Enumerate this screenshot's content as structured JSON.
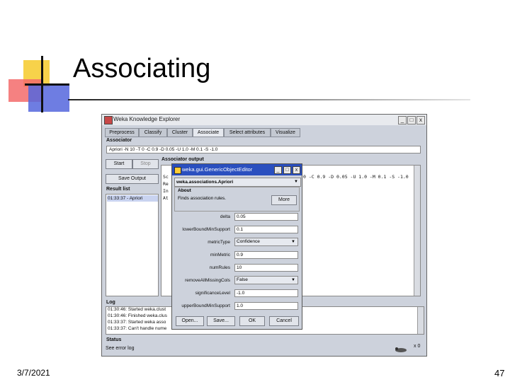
{
  "slide": {
    "title": "Associating",
    "date": "3/7/2021",
    "page_number": "47"
  },
  "window": {
    "title": "Weka Knowledge Explorer",
    "minimize": "_",
    "maximize": "□",
    "close": "x"
  },
  "tabs": [
    {
      "label": "Preprocess"
    },
    {
      "label": "Classify"
    },
    {
      "label": "Cluster"
    },
    {
      "label": "Associate"
    },
    {
      "label": "Select attributes"
    },
    {
      "label": "Visualize"
    }
  ],
  "associator": {
    "label": "Associator",
    "value": "Apriori -N 10 -T 0 -C 0.9 -D 0.05 -U 1.0 -M 0.1 -S -1.0"
  },
  "controls": {
    "start": "Start",
    "stop": "Stop",
    "save_output": "Save Output",
    "result_list_label": "Result list",
    "result_item": "01:33:37 - Apriori"
  },
  "output": {
    "label": "Associator output",
    "lines": [
      "Sc",
      "Re",
      "In",
      "At"
    ],
    "right_text": "0 -C 0.9 -D 0.05 -U 1.0 -M 0.1 -S -1.0"
  },
  "log": {
    "label": "Log",
    "lines": [
      "01:30:46: Started weka.clust",
      "01:30:46: Finished weka.clus",
      "01:33:37: Started weka asso",
      "01:33:37: Can't handle nume"
    ]
  },
  "status": {
    "label": "Status",
    "text": "See error log",
    "count": "x 0"
  },
  "dialog": {
    "title": "weka.gui.GenericObjectEditor",
    "class_name": "weka.associations.Apriori",
    "about_label": "About",
    "about_text": "Finds association rules.",
    "more_button": "More",
    "params": {
      "delta": {
        "label": "delta",
        "value": "0.05"
      },
      "lowerBoundMinSupport": {
        "label": "lowerBoundMinSupport",
        "value": "0.1"
      },
      "metricType": {
        "label": "metricType",
        "value": "Confidence"
      },
      "minMetric": {
        "label": "minMetric",
        "value": "0.9"
      },
      "numRules": {
        "label": "numRules",
        "value": "10"
      },
      "removeAllMissingCols": {
        "label": "removeAllMissingCols",
        "value": "False"
      },
      "significanceLevel": {
        "label": "significanceLevel",
        "value": "-1.0"
      },
      "upperBoundMinSupport": {
        "label": "upperBoundMinSupport",
        "value": "1.0"
      }
    },
    "buttons": {
      "open": "Open...",
      "save": "Save...",
      "ok": "OK",
      "cancel": "Cancel"
    }
  }
}
